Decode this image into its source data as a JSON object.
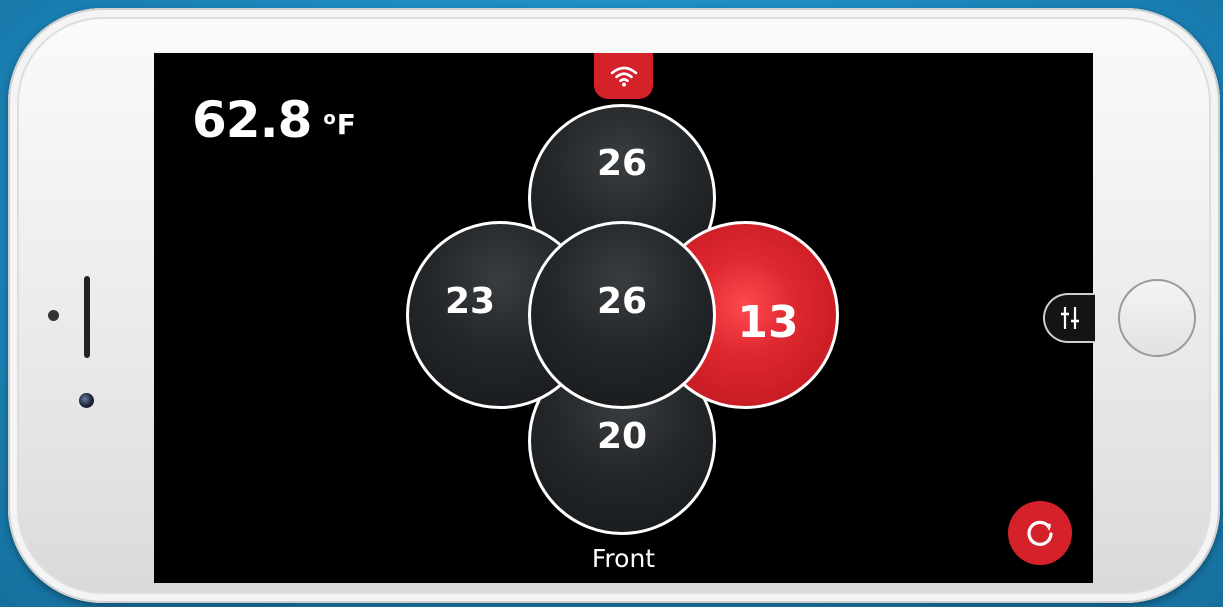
{
  "temperature": {
    "value": "62.8",
    "degree_symbol": "o",
    "unit": "F"
  },
  "status": {
    "connection_icon": "wifi-icon",
    "accent_color": "#d4212a"
  },
  "tires": {
    "top": {
      "value": "26"
    },
    "left": {
      "value": "23"
    },
    "center": {
      "value": "26"
    },
    "right": {
      "value": "13",
      "alert": true
    },
    "bottom": {
      "value": "20"
    }
  },
  "orientation_label": "Front",
  "controls": {
    "settings_icon": "sliders-icon",
    "refresh_icon": "refresh-icon"
  }
}
